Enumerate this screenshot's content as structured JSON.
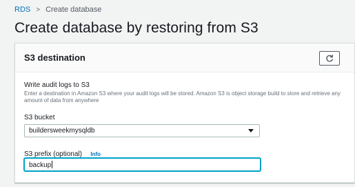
{
  "breadcrumb": {
    "root": "RDS",
    "separator": ">",
    "current": "Create database"
  },
  "page": {
    "title": "Create database by restoring from S3"
  },
  "panel": {
    "title": "S3 destination",
    "refresh_icon": "refresh-icon",
    "audit": {
      "label": "Write audit logs to S3",
      "description": "Enter a destination in Amazon S3 where your audit logs will be stored. Amazon S3 is object storage build to store and retrieve any amount of data from anywhere"
    },
    "bucket": {
      "label": "S3 bucket",
      "selected": "buildersweekmysqldb"
    },
    "prefix": {
      "label": "S3 prefix (optional)",
      "info": "Info",
      "value": "backup"
    }
  },
  "colors": {
    "link": "#0073bb",
    "focus": "#00a1c9",
    "background": "#f2f3f3"
  }
}
